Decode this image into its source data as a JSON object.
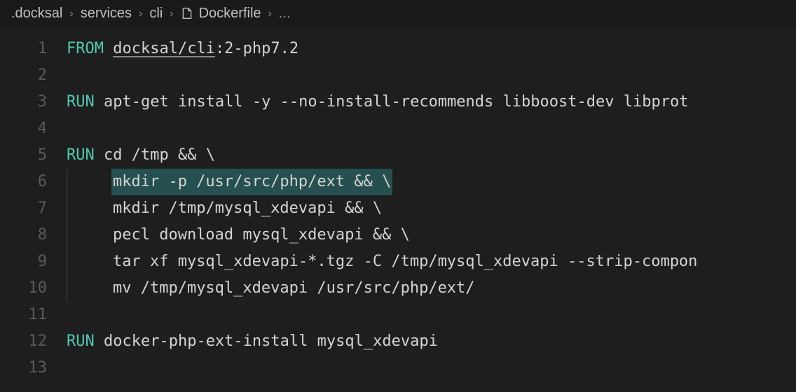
{
  "breadcrumbs": {
    "items": [
      ".docksal",
      "services",
      "cli",
      "Dockerfile",
      "..."
    ]
  },
  "line_numbers": [
    "1",
    "2",
    "3",
    "4",
    "5",
    "6",
    "7",
    "8",
    "9",
    "10",
    "11",
    "12",
    "13"
  ],
  "code": {
    "line1": {
      "keyword": "FROM",
      "image": "docksal/cli",
      "tag": ":2-php7.2"
    },
    "line3": {
      "keyword": "RUN",
      "cmd": " apt-get install -y --no-install-recommends libboost-dev libprot"
    },
    "line5": {
      "keyword": "RUN",
      "cmd": " cd /tmp && \\"
    },
    "line6": {
      "indent": "    ",
      "cmd": "mkdir -p /usr/src/php/ext && \\"
    },
    "line7": {
      "indent": "    ",
      "cmd": "mkdir /tmp/mysql_xdevapi && \\"
    },
    "line8": {
      "indent": "    ",
      "cmd": "pecl download mysql_xdevapi && \\"
    },
    "line9": {
      "indent": "    ",
      "cmd": "tar xf mysql_xdevapi-*.tgz -C /tmp/mysql_xdevapi --strip-compon"
    },
    "line10": {
      "indent": "    ",
      "cmd": "mv /tmp/mysql_xdevapi /usr/src/php/ext/"
    },
    "line12": {
      "keyword": "RUN",
      "cmd": " docker-php-ext-install mysql_xdevapi"
    }
  },
  "chevron": "›"
}
